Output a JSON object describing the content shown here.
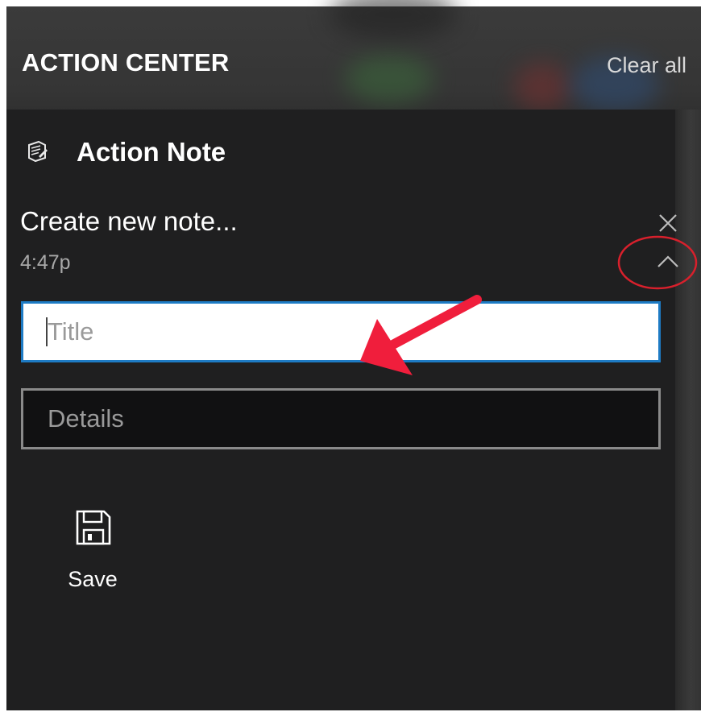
{
  "header": {
    "title": "ACTION CENTER",
    "clear_all_label": "Clear all"
  },
  "notification": {
    "app_name": "Action Note",
    "app_icon": "note-icon",
    "heading": "Create new note...",
    "time": "4:47p",
    "close_icon": "close-icon",
    "collapse_icon": "chevron-up-icon",
    "title_field": {
      "value": "",
      "placeholder": "Title"
    },
    "details_field": {
      "value": "",
      "placeholder": "Details"
    },
    "save_button": {
      "label": "Save",
      "icon": "save-icon"
    }
  },
  "annotations": {
    "arrow_color": "#f01e3c",
    "circle_color": "#d8202c"
  },
  "colors": {
    "panel_bg": "#1f1f20",
    "accent": "#1e7bc4"
  }
}
